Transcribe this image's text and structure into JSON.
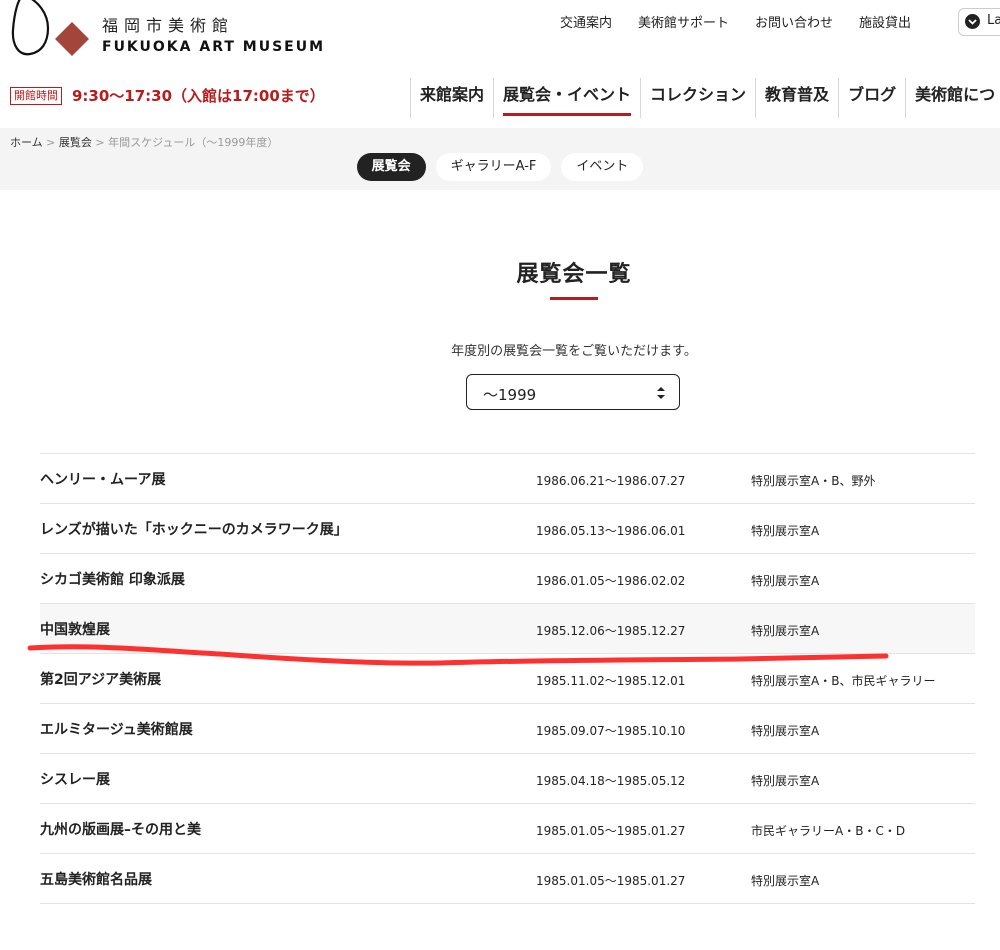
{
  "header": {
    "logo_jp": "福岡市美術館",
    "logo_en": "FUKUOKA ART MUSEUM",
    "utility_links": [
      "交通案内",
      "美術館サポート",
      "お問い合わせ",
      "施設貸出"
    ],
    "language_label": "La"
  },
  "hours": {
    "badge": "開館時間",
    "text": "9:30～17:30（入館は17:00まで）"
  },
  "main_nav": [
    "来館案内",
    "展覧会・イベント",
    "コレクション",
    "教育普及",
    "ブログ",
    "美術館につ"
  ],
  "breadcrumb": {
    "home": "ホーム",
    "sep": ">",
    "section": "展覧会",
    "current": "年間スケジュール（～1999年度）"
  },
  "tabs": [
    "展覧会",
    "ギャラリーA-F",
    "イベント"
  ],
  "page": {
    "title": "展覧会一覧",
    "intro": "年度別の展覧会一覧をご覧いただけます。",
    "year_select": "～1999"
  },
  "exhibitions": [
    {
      "title": "ヘンリー・ムーア展",
      "period": "1986.06.21～1986.07.27",
      "venue": "特別展示室A・B、野外"
    },
    {
      "title": "レンズが描いた「ホックニーのカメラワーク展」",
      "period": "1986.05.13～1986.06.01",
      "venue": "特別展示室A"
    },
    {
      "title": "シカゴ美術館 印象派展",
      "period": "1986.01.05～1986.02.02",
      "venue": "特別展示室A"
    },
    {
      "title": "中国敦煌展",
      "period": "1985.12.06～1985.12.27",
      "venue": "特別展示室A"
    },
    {
      "title": "第2回アジア美術展",
      "period": "1985.11.02～1985.12.01",
      "venue": "特別展示室A・B、市民ギャラリー"
    },
    {
      "title": "エルミタージュ美術館展",
      "period": "1985.09.07～1985.10.10",
      "venue": "特別展示室A"
    },
    {
      "title": "シスレー展",
      "period": "1985.04.18～1985.05.12",
      "venue": "特別展示室A"
    },
    {
      "title": "九州の版画展–その用と美",
      "period": "1985.01.05～1985.01.27",
      "venue": "市民ギャラリーA・B・C・D"
    },
    {
      "title": "五島美術館名品展",
      "period": "1985.01.05～1985.01.27",
      "venue": "特別展示室A"
    }
  ],
  "colors": {
    "accent": "#b71c1c",
    "annotation": "#ff1a1a",
    "pill_active": "#222222"
  }
}
